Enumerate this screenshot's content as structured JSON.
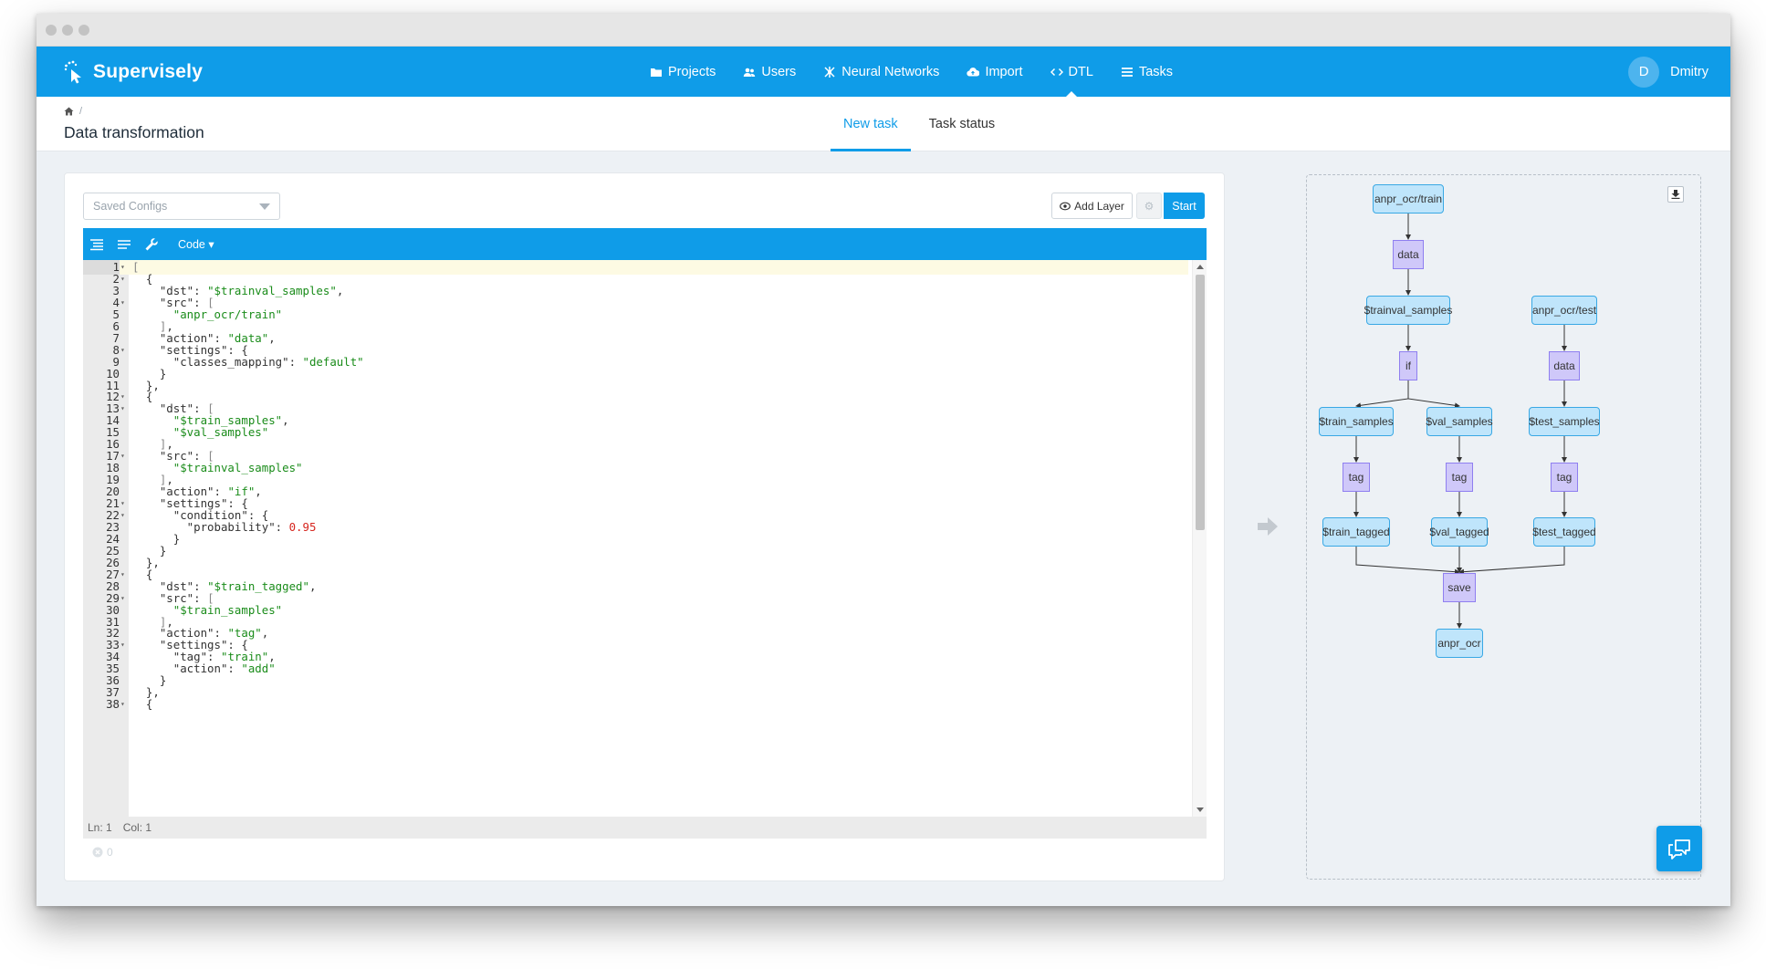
{
  "app": {
    "name": "Supervisely"
  },
  "nav": {
    "items": [
      {
        "label": "Projects",
        "icon": "folder-icon"
      },
      {
        "label": "Users",
        "icon": "users-icon"
      },
      {
        "label": "Neural Networks",
        "icon": "network-icon"
      },
      {
        "label": "Import",
        "icon": "cloud-upload-icon"
      },
      {
        "label": "DTL",
        "icon": "code-icon",
        "active": true
      },
      {
        "label": "Tasks",
        "icon": "list-icon"
      }
    ]
  },
  "user": {
    "initial": "D",
    "name": "Dmitry"
  },
  "breadcrumb": {
    "separator": "/"
  },
  "page": {
    "title": "Data transformation"
  },
  "tabs": [
    {
      "label": "New task",
      "active": true
    },
    {
      "label": "Task status",
      "active": false
    }
  ],
  "toolbar": {
    "saved_configs_placeholder": "Saved Configs",
    "add_layer_label": "Add Layer",
    "start_label": "Start",
    "code_mode_label": "Code ▾"
  },
  "editor": {
    "status": {
      "line": "Ln: 1",
      "col": "Col: 1"
    },
    "error_count": "0",
    "lines": [
      {
        "n": "1",
        "fold": true,
        "tokens": [
          [
            "p",
            "["
          ]
        ]
      },
      {
        "n": "2",
        "fold": true,
        "tokens": [
          [
            "",
            "  {"
          ]
        ]
      },
      {
        "n": "3",
        "tokens": [
          [
            "",
            "    \"dst\": "
          ],
          [
            "s",
            "\"$trainval_samples\""
          ],
          [
            "",
            ","
          ]
        ]
      },
      {
        "n": "4",
        "fold": true,
        "tokens": [
          [
            "",
            "    \"src\": "
          ],
          [
            "p",
            "["
          ]
        ]
      },
      {
        "n": "5",
        "tokens": [
          [
            "s",
            "      \"anpr_ocr/train\""
          ]
        ]
      },
      {
        "n": "6",
        "tokens": [
          [
            "p",
            "    ]"
          ],
          [
            "",
            ","
          ]
        ]
      },
      {
        "n": "7",
        "tokens": [
          [
            "",
            "    \"action\": "
          ],
          [
            "s",
            "\"data\""
          ],
          [
            "",
            ","
          ]
        ]
      },
      {
        "n": "8",
        "fold": true,
        "tokens": [
          [
            "",
            "    \"settings\": {"
          ]
        ]
      },
      {
        "n": "9",
        "tokens": [
          [
            "",
            "      \"classes_mapping\": "
          ],
          [
            "s",
            "\"default\""
          ]
        ]
      },
      {
        "n": "10",
        "tokens": [
          [
            "",
            "    }"
          ]
        ]
      },
      {
        "n": "11",
        "tokens": [
          [
            "",
            "  },"
          ]
        ]
      },
      {
        "n": "12",
        "fold": true,
        "tokens": [
          [
            "",
            "  {"
          ]
        ]
      },
      {
        "n": "13",
        "fold": true,
        "tokens": [
          [
            "",
            "    \"dst\": "
          ],
          [
            "p",
            "["
          ]
        ]
      },
      {
        "n": "14",
        "tokens": [
          [
            "s",
            "      \"$train_samples\""
          ],
          [
            "",
            ","
          ]
        ]
      },
      {
        "n": "15",
        "tokens": [
          [
            "s",
            "      \"$val_samples\""
          ]
        ]
      },
      {
        "n": "16",
        "tokens": [
          [
            "p",
            "    ]"
          ],
          [
            "",
            ","
          ]
        ]
      },
      {
        "n": "17",
        "fold": true,
        "tokens": [
          [
            "",
            "    \"src\": "
          ],
          [
            "p",
            "["
          ]
        ]
      },
      {
        "n": "18",
        "tokens": [
          [
            "s",
            "      \"$trainval_samples\""
          ]
        ]
      },
      {
        "n": "19",
        "tokens": [
          [
            "p",
            "    ]"
          ],
          [
            "",
            ","
          ]
        ]
      },
      {
        "n": "20",
        "tokens": [
          [
            "",
            "    \"action\": "
          ],
          [
            "s",
            "\"if\""
          ],
          [
            "",
            ","
          ]
        ]
      },
      {
        "n": "21",
        "fold": true,
        "tokens": [
          [
            "",
            "    \"settings\": {"
          ]
        ]
      },
      {
        "n": "22",
        "fold": true,
        "tokens": [
          [
            "",
            "      \"condition\": {"
          ]
        ]
      },
      {
        "n": "23",
        "tokens": [
          [
            "",
            "        \"probability\": "
          ],
          [
            "n",
            "0.95"
          ]
        ]
      },
      {
        "n": "24",
        "tokens": [
          [
            "",
            "      }"
          ]
        ]
      },
      {
        "n": "25",
        "tokens": [
          [
            "",
            "    }"
          ]
        ]
      },
      {
        "n": "26",
        "tokens": [
          [
            "",
            "  },"
          ]
        ]
      },
      {
        "n": "27",
        "fold": true,
        "tokens": [
          [
            "",
            "  {"
          ]
        ]
      },
      {
        "n": "28",
        "tokens": [
          [
            "",
            "    \"dst\": "
          ],
          [
            "s",
            "\"$train_tagged\""
          ],
          [
            "",
            ","
          ]
        ]
      },
      {
        "n": "29",
        "fold": true,
        "tokens": [
          [
            "",
            "    \"src\": "
          ],
          [
            "p",
            "["
          ]
        ]
      },
      {
        "n": "30",
        "tokens": [
          [
            "s",
            "      \"$train_samples\""
          ]
        ]
      },
      {
        "n": "31",
        "tokens": [
          [
            "p",
            "    ]"
          ],
          [
            "",
            ","
          ]
        ]
      },
      {
        "n": "32",
        "tokens": [
          [
            "",
            "    \"action\": "
          ],
          [
            "s",
            "\"tag\""
          ],
          [
            "",
            ","
          ]
        ]
      },
      {
        "n": "33",
        "fold": true,
        "tokens": [
          [
            "",
            "    \"settings\": {"
          ]
        ]
      },
      {
        "n": "34",
        "tokens": [
          [
            "",
            "      \"tag\": "
          ],
          [
            "s",
            "\"train\""
          ],
          [
            "",
            ","
          ]
        ]
      },
      {
        "n": "35",
        "tokens": [
          [
            "",
            "      \"action\": "
          ],
          [
            "s",
            "\"add\""
          ]
        ]
      },
      {
        "n": "36",
        "tokens": [
          [
            "",
            "    }"
          ]
        ]
      },
      {
        "n": "37",
        "tokens": [
          [
            "",
            "  },"
          ]
        ]
      },
      {
        "n": "38",
        "fold": true,
        "tokens": [
          [
            "",
            "  {"
          ]
        ]
      }
    ]
  },
  "graph": {
    "nodes": [
      {
        "id": "n1",
        "label": "anpr_ocr/train",
        "kind": "data"
      },
      {
        "id": "n2",
        "label": "data",
        "kind": "op"
      },
      {
        "id": "n3",
        "label": "$trainval_samples",
        "kind": "data"
      },
      {
        "id": "n4",
        "label": "anpr_ocr/test",
        "kind": "data"
      },
      {
        "id": "n5",
        "label": "if",
        "kind": "op"
      },
      {
        "id": "n6",
        "label": "data",
        "kind": "op"
      },
      {
        "id": "n7",
        "label": "$train_samples",
        "kind": "data"
      },
      {
        "id": "n8",
        "label": "$val_samples",
        "kind": "data"
      },
      {
        "id": "n9",
        "label": "$test_samples",
        "kind": "data"
      },
      {
        "id": "n10",
        "label": "tag",
        "kind": "op"
      },
      {
        "id": "n11",
        "label": "tag",
        "kind": "op"
      },
      {
        "id": "n12",
        "label": "tag",
        "kind": "op"
      },
      {
        "id": "n13",
        "label": "$train_tagged",
        "kind": "data"
      },
      {
        "id": "n14",
        "label": "$val_tagged",
        "kind": "data"
      },
      {
        "id": "n15",
        "label": "$test_tagged",
        "kind": "data"
      },
      {
        "id": "n16",
        "label": "save",
        "kind": "op"
      },
      {
        "id": "n17",
        "label": "anpr_ocr",
        "kind": "data"
      }
    ],
    "edges": [
      [
        "n1",
        "n2"
      ],
      [
        "n2",
        "n3"
      ],
      [
        "n3",
        "n5"
      ],
      [
        "n4",
        "n6"
      ],
      [
        "n5",
        "n7"
      ],
      [
        "n5",
        "n8"
      ],
      [
        "n6",
        "n9"
      ],
      [
        "n7",
        "n10"
      ],
      [
        "n8",
        "n11"
      ],
      [
        "n9",
        "n12"
      ],
      [
        "n10",
        "n13"
      ],
      [
        "n11",
        "n14"
      ],
      [
        "n12",
        "n15"
      ],
      [
        "n13",
        "n16"
      ],
      [
        "n14",
        "n16"
      ],
      [
        "n15",
        "n16"
      ],
      [
        "n16",
        "n17"
      ]
    ]
  },
  "colors": {
    "accent": "#0f9ce8",
    "data_node": "#bfe5fb",
    "op_node": "#cfc8f9",
    "string": "#1a8c1a",
    "number": "#d6261f"
  }
}
